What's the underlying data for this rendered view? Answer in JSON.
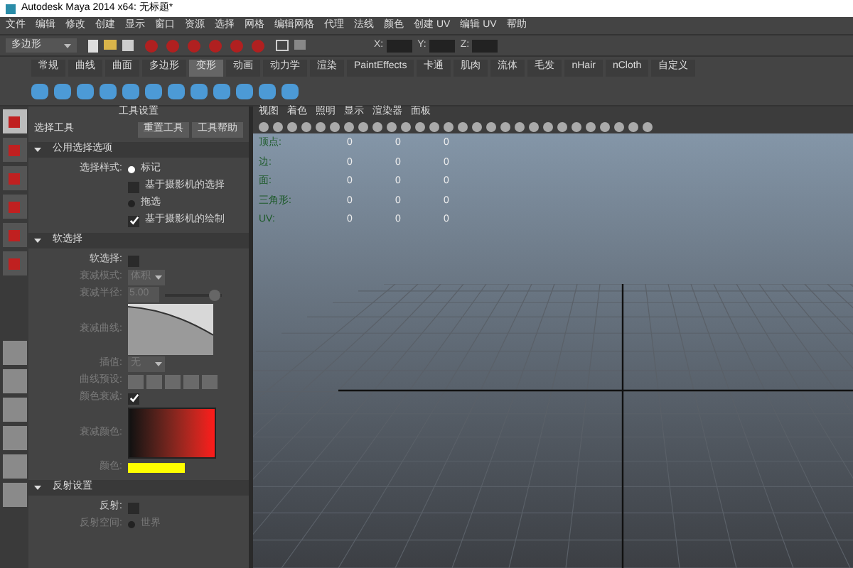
{
  "window": {
    "title": "Autodesk Maya 2014 x64: 无标题*"
  },
  "menu_bar": [
    "文件",
    "编辑",
    "修改",
    "创建",
    "显示",
    "窗口",
    "资源",
    "选择",
    "网格",
    "编辑网格",
    "代理",
    "法线",
    "颜色",
    "创建 UV",
    "编辑 UV",
    "帮助"
  ],
  "status_line": {
    "mode": "多边形",
    "fields": [
      {
        "label": "X:"
      },
      {
        "label": "Y:"
      },
      {
        "label": "Z:"
      }
    ]
  },
  "shelf_tabs": [
    {
      "label": "常规",
      "selected": false
    },
    {
      "label": "曲线",
      "selected": false
    },
    {
      "label": "曲面",
      "selected": false
    },
    {
      "label": "多边形",
      "selected": false
    },
    {
      "label": "变形",
      "selected": true
    },
    {
      "label": "动画",
      "selected": false
    },
    {
      "label": "动力学",
      "selected": false
    },
    {
      "label": "渲染",
      "selected": false
    },
    {
      "label": "PaintEffects",
      "selected": false
    },
    {
      "label": "卡通",
      "selected": false
    },
    {
      "label": "肌肉",
      "selected": false
    },
    {
      "label": "流体",
      "selected": false
    },
    {
      "label": "毛发",
      "selected": false
    },
    {
      "label": "nHair",
      "selected": false
    },
    {
      "label": "nCloth",
      "selected": false
    },
    {
      "label": "自定义",
      "selected": false
    }
  ],
  "toolbox": [
    {
      "selected": true
    },
    {
      "selected": false
    },
    {
      "selected": false
    },
    {
      "selected": false
    },
    {
      "selected": false
    },
    {
      "selected": false
    }
  ],
  "tool_settings": {
    "title": "工具设置",
    "tool_name": "选择工具",
    "buttons": [
      "重置工具",
      "工具帮助"
    ],
    "sections": [
      {
        "title": "公用选择选项",
        "expanded": true,
        "rows": [
          {
            "kind": "radio",
            "label": "选择样式:",
            "option": "标记",
            "selected": true
          },
          {
            "kind": "check",
            "option": "基于摄影机的选择",
            "checked": false
          },
          {
            "kind": "radio",
            "option": "拖选",
            "selected": false
          },
          {
            "kind": "check",
            "option": "基于摄影机的绘制",
            "checked": true
          }
        ]
      },
      {
        "title": "软选择",
        "expanded": true,
        "rows": [
          {
            "kind": "check",
            "label": "软选择:",
            "checked": false
          },
          {
            "kind": "dropdown",
            "label": "衰减模式:",
            "value": "体积",
            "disabled": true
          },
          {
            "kind": "slider",
            "label": "衰减半径:",
            "value": "5.00",
            "level": 0.85,
            "disabled": true
          },
          {
            "kind": "curve",
            "label": "衰减曲线:",
            "disabled": true
          },
          {
            "kind": "dropdown",
            "label": "插值:",
            "value": "无",
            "disabled": true
          },
          {
            "kind": "presets",
            "label": "曲线预设:",
            "disabled": true
          },
          {
            "kind": "check",
            "label": "颜色衰减:",
            "checked": true,
            "disabled": true
          },
          {
            "kind": "gradient",
            "label": "衰减颜色:",
            "disabled": true
          },
          {
            "kind": "color",
            "label": "颜色:",
            "color": "#ffff00",
            "disabled": true
          }
        ]
      },
      {
        "title": "反射设置",
        "expanded": true,
        "rows": [
          {
            "kind": "check",
            "label": "反射:",
            "checked": false
          },
          {
            "kind": "radio",
            "label": "反射空间:",
            "option": "世界",
            "selected": false,
            "disabled": true
          }
        ]
      }
    ]
  },
  "viewport": {
    "menu": [
      "视图",
      "着色",
      "照明",
      "显示",
      "渲染器",
      "面板"
    ],
    "hud": [
      {
        "label": "顶点:",
        "values": [
          "0",
          "0",
          "0"
        ]
      },
      {
        "label": "边:",
        "values": [
          "0",
          "0",
          "0"
        ]
      },
      {
        "label": "面:",
        "values": [
          "0",
          "0",
          "0"
        ]
      },
      {
        "label": "三角形:",
        "values": [
          "0",
          "0",
          "0"
        ]
      },
      {
        "label": "UV:",
        "values": [
          "0",
          "0",
          "0"
        ]
      }
    ]
  }
}
